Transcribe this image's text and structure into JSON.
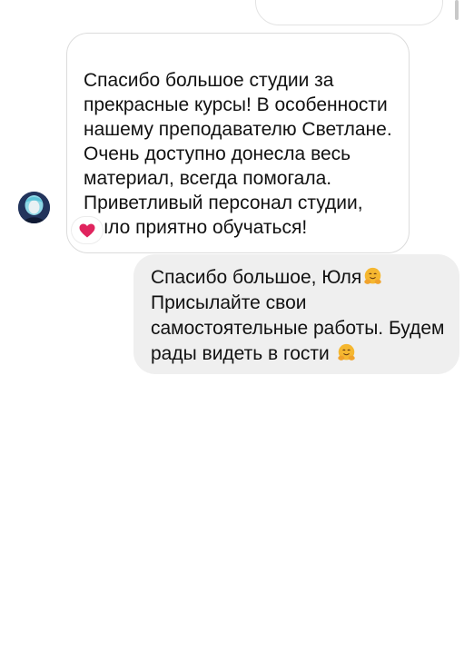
{
  "conversation": {
    "incoming_message": {
      "text": "Спасибо большое студии за\nпрекрасные курсы! В особенности\nнашему преподавателю Светлане.\nОчень доступно донесла весь\nматериал, всегда помогала.\nПриветливый персонал студии,\nбыло приятно обучаться!",
      "reaction": "heart-icon"
    },
    "outgoing_message": {
      "line1": "Спасибо большое, Юля",
      "line2": "Присылайте свои",
      "line3": "самостоятельные работы. Будем",
      "line4": "рады видеть в гости",
      "emoji": "hugging-face-icon"
    }
  },
  "colors": {
    "outgoing_bubble": "#efefef",
    "incoming_border": "#dcdcdc",
    "heart": "#e0245e",
    "emoji": "#f5b730"
  }
}
